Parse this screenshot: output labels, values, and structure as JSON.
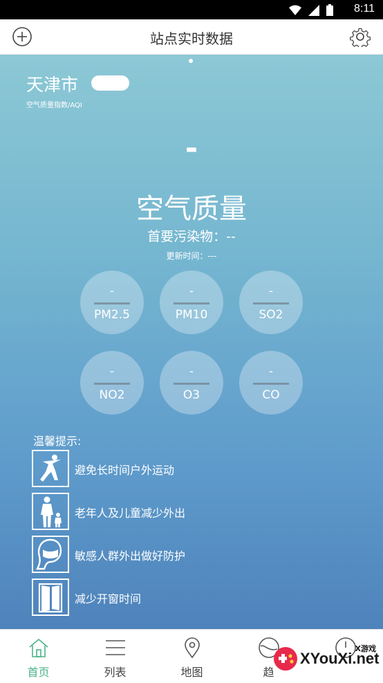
{
  "status_bar": {
    "time": "8:11"
  },
  "app_bar": {
    "title": "站点实时数据",
    "left_icon": "add-circle-icon",
    "right_icon": "gear-icon"
  },
  "main": {
    "city": "天津市",
    "aqi_label": "空气质量指数/AQI",
    "aqi_value": "-",
    "quality": "空气质量",
    "primary_pollutant": "首要污染物：--",
    "update_time": "更新时间：---",
    "pollutants": [
      {
        "value": "-",
        "name": "PM2.5"
      },
      {
        "value": "-",
        "name": "PM10"
      },
      {
        "value": "-",
        "name": "SO2"
      },
      {
        "value": "-",
        "name": "NO2"
      },
      {
        "value": "-",
        "name": "O3"
      },
      {
        "value": "-",
        "name": "CO"
      }
    ],
    "tips_title": "温馨提示:",
    "tips": [
      {
        "icon": "running-person-icon",
        "text": "避免长时间户外运动"
      },
      {
        "icon": "elder-child-icon",
        "text": "老年人及儿童减少外出"
      },
      {
        "icon": "mask-face-icon",
        "text": "敏感人群外出做好防护"
      },
      {
        "icon": "window-icon",
        "text": "减少开窗时间"
      }
    ]
  },
  "tab_bar": {
    "tabs": [
      {
        "label": "首页",
        "icon": "home-icon",
        "active": true
      },
      {
        "label": "列表",
        "icon": "list-icon",
        "active": false
      },
      {
        "label": "地图",
        "icon": "map-pin-icon",
        "active": false
      },
      {
        "label": "趋",
        "icon": "trend-icon",
        "active": false
      },
      {
        "label": "",
        "icon": "clock-icon",
        "active": false
      }
    ]
  },
  "watermark": {
    "small": "X游戏",
    "text": "XYouXi.net"
  },
  "colors": {
    "accent": "#4ab389",
    "gradient_top": "#8cc8d5",
    "gradient_bottom": "#4e83bb"
  }
}
